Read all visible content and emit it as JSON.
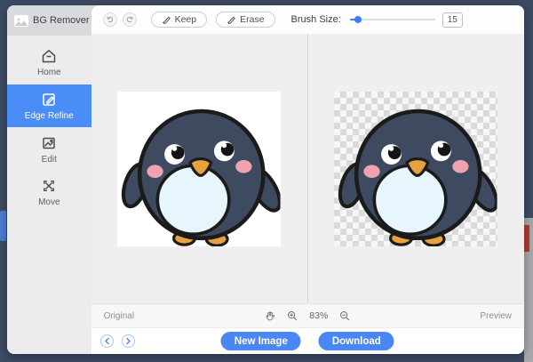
{
  "app": {
    "title": "BG Remover"
  },
  "sidebar": {
    "items": [
      {
        "label": "Home",
        "active": false
      },
      {
        "label": "Edge Refine",
        "active": true
      },
      {
        "label": "Edit",
        "active": false
      },
      {
        "label": "Move",
        "active": false
      }
    ]
  },
  "toolbar": {
    "keep_label": "Keep",
    "erase_label": "Erase",
    "brush_size_label": "Brush Size:",
    "brush_size_value": "15"
  },
  "status": {
    "left_label": "Original",
    "zoom_level": "83%",
    "right_label": "Preview"
  },
  "footer": {
    "new_image_label": "New Image",
    "download_label": "Download"
  },
  "icons": {
    "logo": "image-icon",
    "home": "home-icon",
    "edge_refine": "edit-pen-icon",
    "edit": "photo-icon",
    "move": "move-arrows-icon",
    "undo": "undo-arrow-icon",
    "redo": "redo-arrow-icon",
    "keep": "brush-icon",
    "erase": "brush-icon",
    "pan": "hand-icon",
    "zoom_in": "magnifier-plus-icon",
    "zoom_out": "magnifier-minus-icon",
    "prev": "chevron-left-icon",
    "next": "chevron-right-icon"
  },
  "colors": {
    "accent": "#4a87f5",
    "active_item": "#4a8df6",
    "frame": "#3c4a62",
    "canvas_bg": "#efefef",
    "checker_light": "#f6f6f6",
    "checker_dark": "#dadada",
    "penguin_body": "#3e4a5f",
    "penguin_belly": "#e7f6fc",
    "penguin_beak": "#e6a23e",
    "penguin_cheek": "#efa3b0"
  }
}
